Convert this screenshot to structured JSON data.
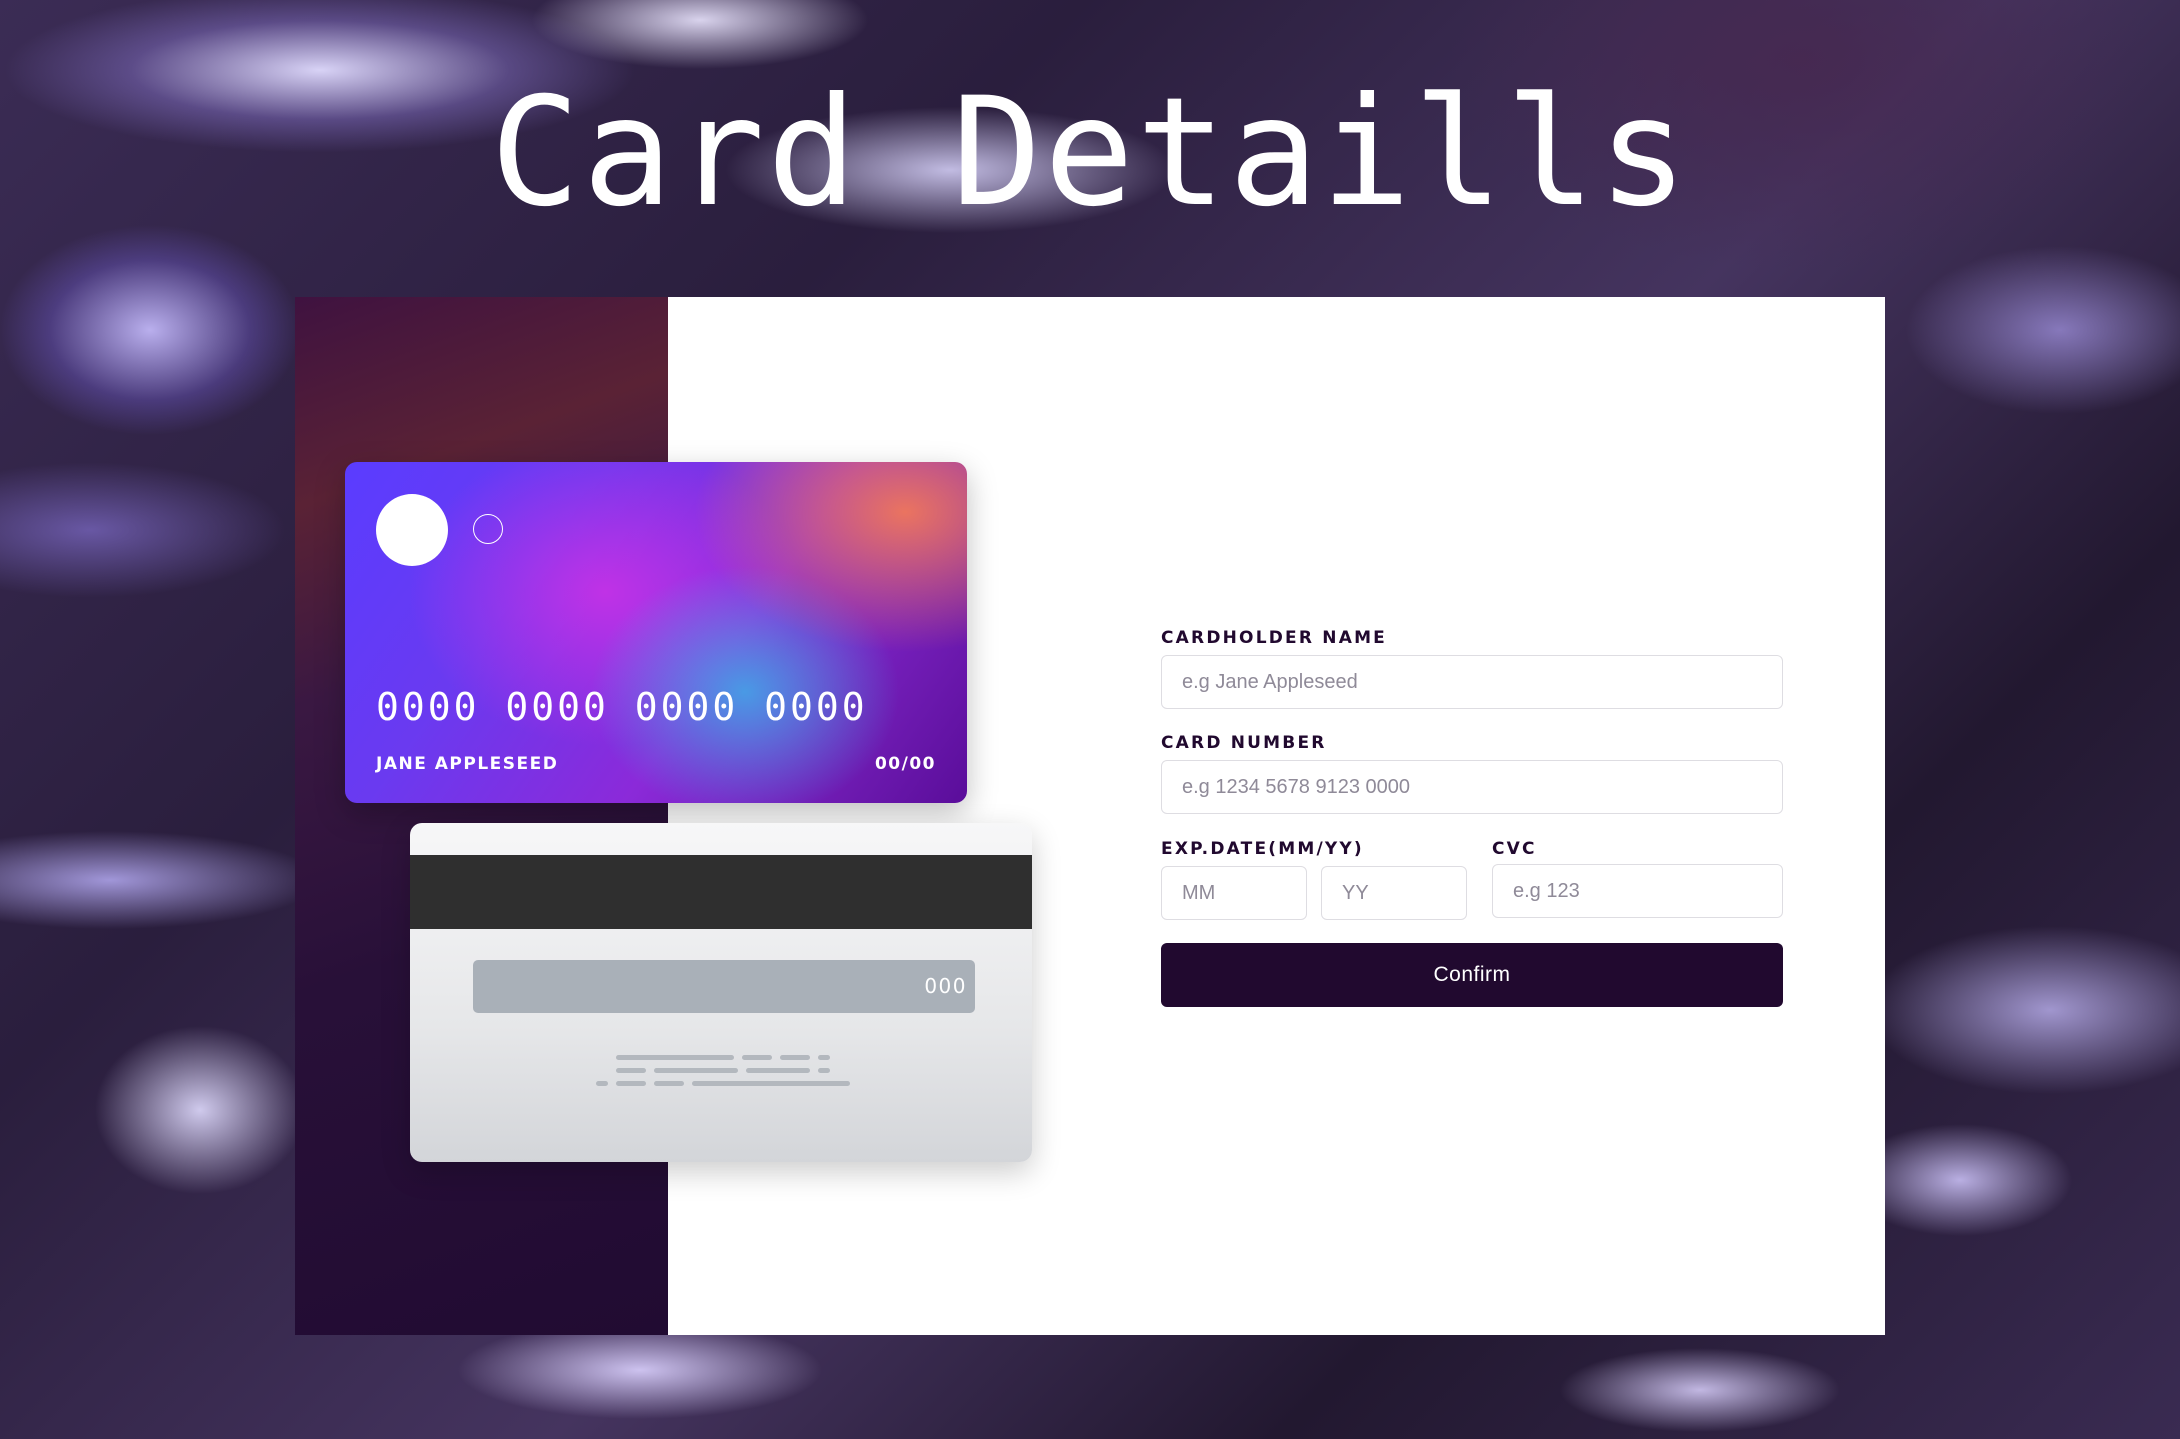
{
  "page": {
    "title": "Card Detaills"
  },
  "card_front": {
    "number": "0000 0000 0000 0000",
    "holder": "JANE APPLESEED",
    "expiry": "00/00"
  },
  "card_back": {
    "cvc": "000"
  },
  "form": {
    "cardholder_name": {
      "label": "CARDHOLDER NAME",
      "placeholder": "e.g Jane Appleseed",
      "value": ""
    },
    "card_number": {
      "label": "CARD NUMBER",
      "placeholder": "e.g 1234 5678 9123 0000",
      "value": ""
    },
    "exp_date": {
      "label": "EXP.DATE(MM/YY)",
      "month_placeholder": "MM",
      "year_placeholder": "YY"
    },
    "cvc": {
      "label": "CVC",
      "placeholder": "e.g 123",
      "value": ""
    },
    "confirm_label": "Confirm"
  },
  "colors": {
    "accent": "#21092f",
    "panel": "#ffffff",
    "input_border": "#dedde2",
    "placeholder": "#8f8a98"
  }
}
